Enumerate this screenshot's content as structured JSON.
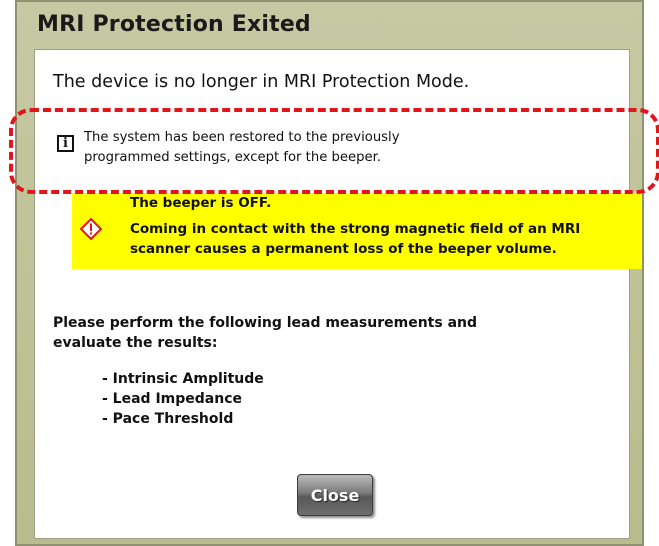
{
  "dialog": {
    "title": "MRI Protection Exited",
    "headline": "The device is no longer in MRI Protection Mode.",
    "info": {
      "icon": "info-icon",
      "text": "The system has been restored to the previously\nprogrammed settings, except for the beeper."
    },
    "warning": {
      "icon": "warning-diamond-icon",
      "title": "The beeper is OFF.",
      "text": "Coming in contact with the strong magnetic field of an MRI\nscanner causes a permanent loss of the beeper volume.",
      "background_color": "#ffff00"
    },
    "instructions": "Please perform the following lead measurements and\nevaluate the results:",
    "measurements": [
      "- Intrinsic Amplitude",
      "- Lead Impedance",
      "- Pace Threshold"
    ],
    "close_label": "Close"
  },
  "colors": {
    "title_bar": "#c6c9a3",
    "highlight_dashes": "#e0161b",
    "warning_icon": "#e0161b"
  }
}
